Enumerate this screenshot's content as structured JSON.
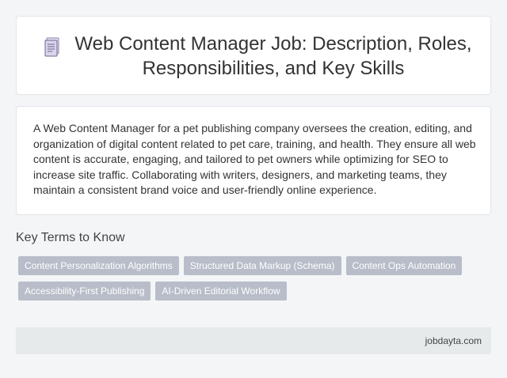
{
  "header": {
    "icon": "document-icon",
    "title": "Web Content Manager Job: Description, Roles, Responsibilities, and Key Skills"
  },
  "description": "A Web Content Manager for a pet publishing company oversees the creation, editing, and organization of digital content related to pet care, training, and health. They ensure all web content is accurate, engaging, and tailored to pet owners while optimizing for SEO to increase site traffic. Collaborating with writers, designers, and marketing teams, they maintain a consistent brand voice and user-friendly online experience.",
  "key_terms": {
    "heading": "Key Terms to Know",
    "tags": [
      "Content Personalization Algorithms",
      "Structured Data Markup (Schema)",
      "Content Ops Automation",
      "Accessibility-First Publishing",
      "AI-Driven Editorial Workflow"
    ]
  },
  "footer": {
    "site": "jobdayta.com"
  },
  "colors": {
    "background": "#f4f5f7",
    "card": "#ffffff",
    "tag_background": "#b8bdc9",
    "footer_background": "#e6eaeb"
  }
}
